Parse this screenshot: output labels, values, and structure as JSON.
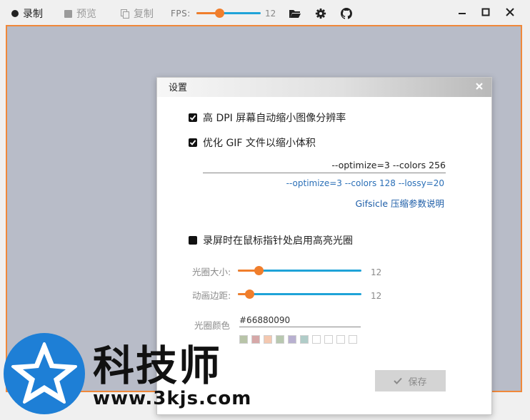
{
  "toolbar": {
    "record_label": "录制",
    "preview_label": "预览",
    "copy_label": "复制",
    "fps_label": "FPS:",
    "fps_value": "12",
    "fps_fraction": 0.35,
    "icons": [
      "record-dot-icon",
      "preview-square-icon",
      "copy-icon",
      "folder-open-icon",
      "gear-icon",
      "github-icon",
      "minimize-icon",
      "maximize-icon",
      "close-icon"
    ]
  },
  "colors": {
    "accent_orange": "#f07e2c",
    "accent_blue": "#1fa3d8",
    "frame_border": "#f0883a",
    "link_blue": "#1e5ea8"
  },
  "dialog": {
    "title": "设置",
    "option_hidpi": "高 DPI 屏幕自动缩小图像分辨率",
    "option_hidpi_checked": true,
    "option_gif_optimize": "优化 GIF 文件以缩小体积",
    "option_gif_optimize_checked": true,
    "optimize_args_value": "--optimize=3 --colors 256",
    "optimize_args_alt": "--optimize=3 --colors 128 --lossy=20",
    "gifsicle_link": "Gifsicle 压缩参数说明",
    "option_highlight": "录屏时在鼠标指针处启用高亮光圈",
    "option_highlight_checked": false,
    "halo_size_label": "光圈大小:",
    "halo_size_value": "12",
    "halo_size_fraction": 0.17,
    "anim_margin_label": "动画边距:",
    "anim_margin_value": "12",
    "anim_margin_fraction": 0.09,
    "halo_color_label": "光圈颜色",
    "halo_color_value": "#66880090",
    "swatches": [
      "#b8c4a8",
      "#d6a8a8",
      "#f4c8b0",
      "#b8c8b0",
      "#b8b0d0",
      "#b0ccc8",
      "#ffffff",
      "#ffffff",
      "#ffffff",
      "#ffffff"
    ],
    "save_label": "保存"
  },
  "watermark": {
    "text": "科技师",
    "url": "www.3kjs.com"
  }
}
